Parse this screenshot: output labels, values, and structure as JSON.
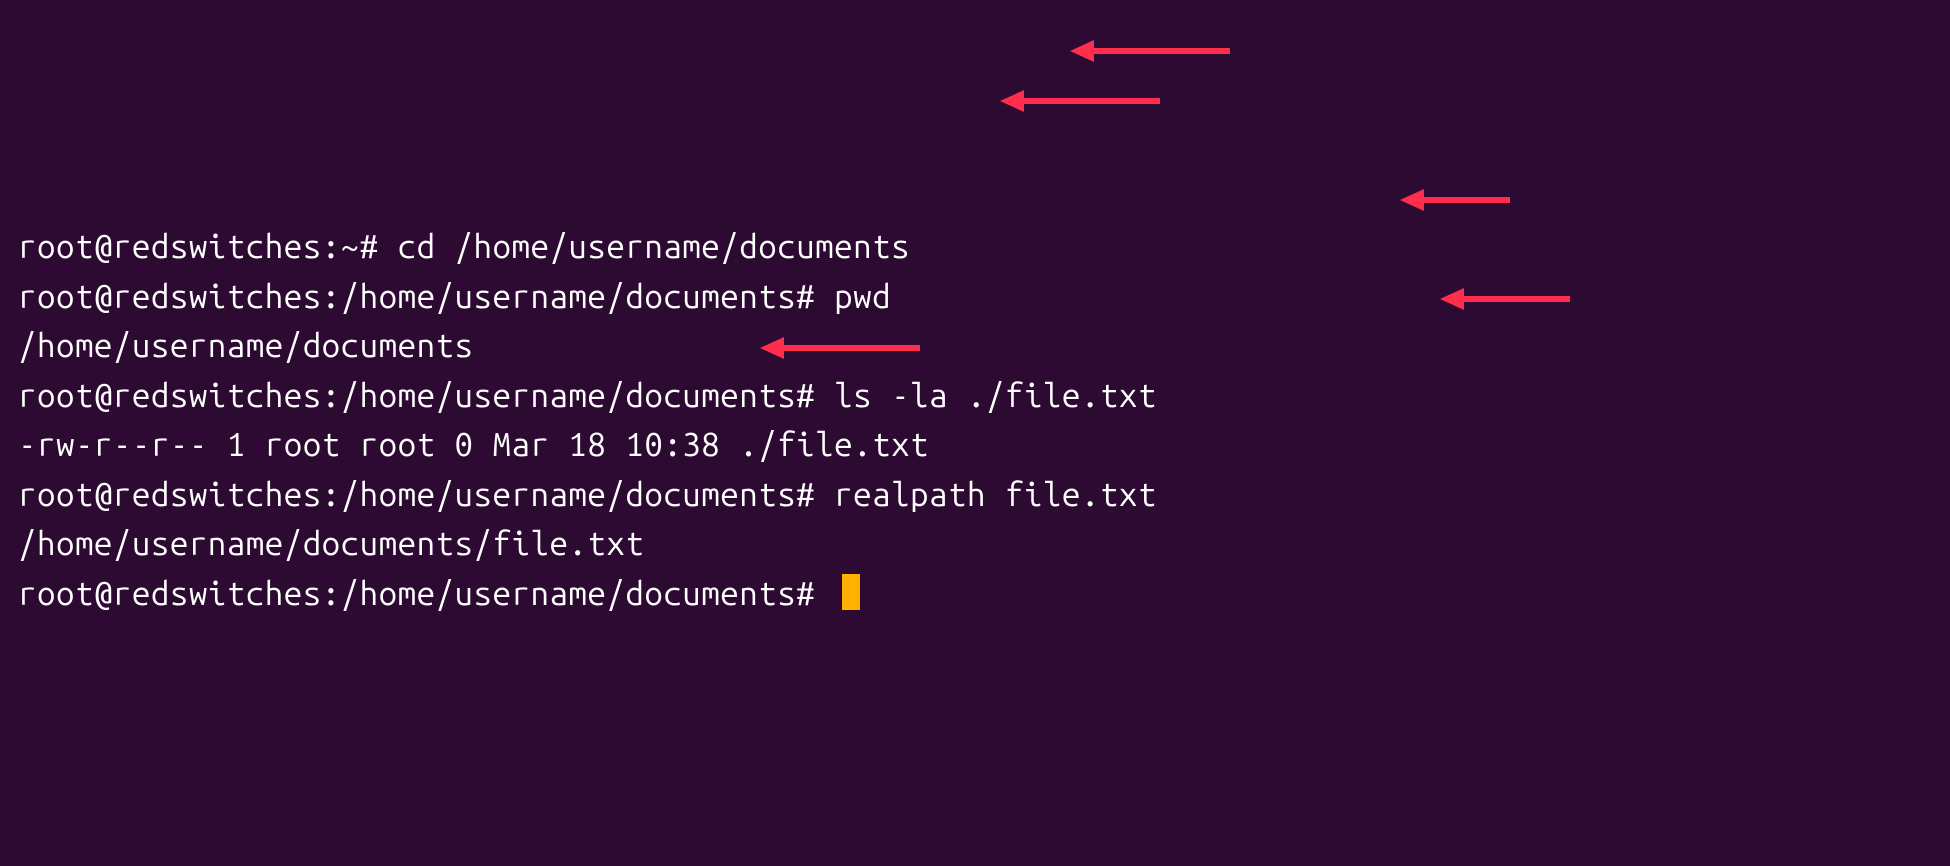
{
  "colors": {
    "bg": "#2d0a31",
    "fg": "#ffffff",
    "cursor": "#ffb000",
    "arrow": "#ff2e4c"
  },
  "lines": [
    {
      "prompt": "root@redswitches:~# ",
      "command": "cd /home/username/documents"
    },
    {
      "prompt": "root@redswitches:/home/username/documents# ",
      "command": "pwd"
    },
    {
      "output": "/home/username/documents"
    },
    {
      "prompt": "root@redswitches:/home/username/documents# ",
      "command": "ls -la ./file.txt"
    },
    {
      "output": "-rw-r--r-- 1 root root 0 Mar 18 10:38 ./file.txt"
    },
    {
      "prompt": "root@redswitches:/home/username/documents# ",
      "command": "realpath file.txt"
    },
    {
      "output": "/home/username/documents/file.txt"
    },
    {
      "prompt": "root@redswitches:/home/username/documents# ",
      "command": "",
      "cursor": true
    }
  ],
  "arrows": [
    {
      "target_line": 0,
      "xstart": 1230,
      "xend": 1070
    },
    {
      "target_line": 1,
      "xstart": 1160,
      "xend": 1000
    },
    {
      "target_line": 3,
      "xstart": 1510,
      "xend": 1400
    },
    {
      "target_line": 5,
      "xstart": 1570,
      "xend": 1440
    },
    {
      "target_line": 6,
      "xstart": 920,
      "xend": 760
    }
  ]
}
